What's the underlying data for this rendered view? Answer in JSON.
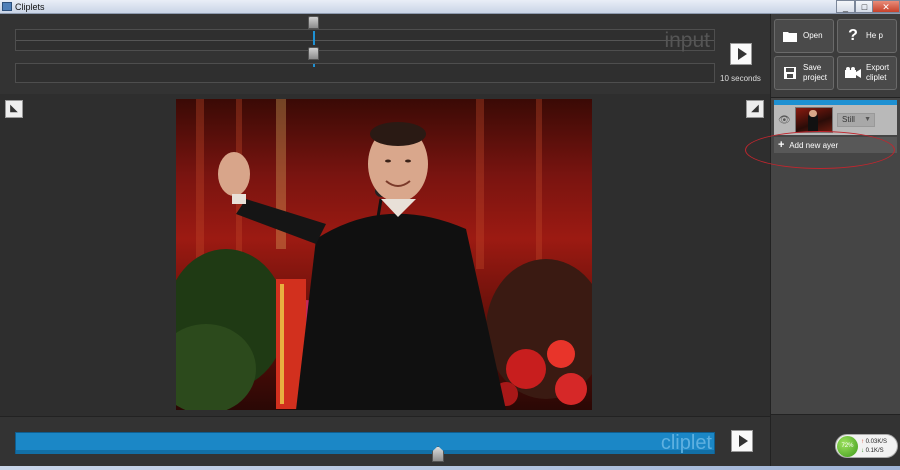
{
  "window": {
    "title": "Cliplets",
    "min": "_",
    "max": "□",
    "close": "✕"
  },
  "top": {
    "input_label": "input",
    "duration": "10 seconds"
  },
  "toolbar": {
    "open": "Open",
    "help": "He p",
    "save": "Save\nproject",
    "export": "Export\ncliplet"
  },
  "layers": {
    "layer_type": "Still",
    "add_layer": "Add new ayer"
  },
  "bottom": {
    "cliplet_label": "cliplet"
  },
  "netmeter": {
    "percent": "72%",
    "up": "0.03K/S",
    "down": "0.1K/S"
  },
  "icons": {
    "play": "play-icon",
    "open": "folder-icon",
    "help": "question-icon",
    "save": "floppy-icon",
    "export": "camera-icon",
    "eye": "eye-icon",
    "plus": "plus-icon"
  },
  "colors": {
    "accent": "#1e90d2",
    "annotation": "#c0262e"
  }
}
